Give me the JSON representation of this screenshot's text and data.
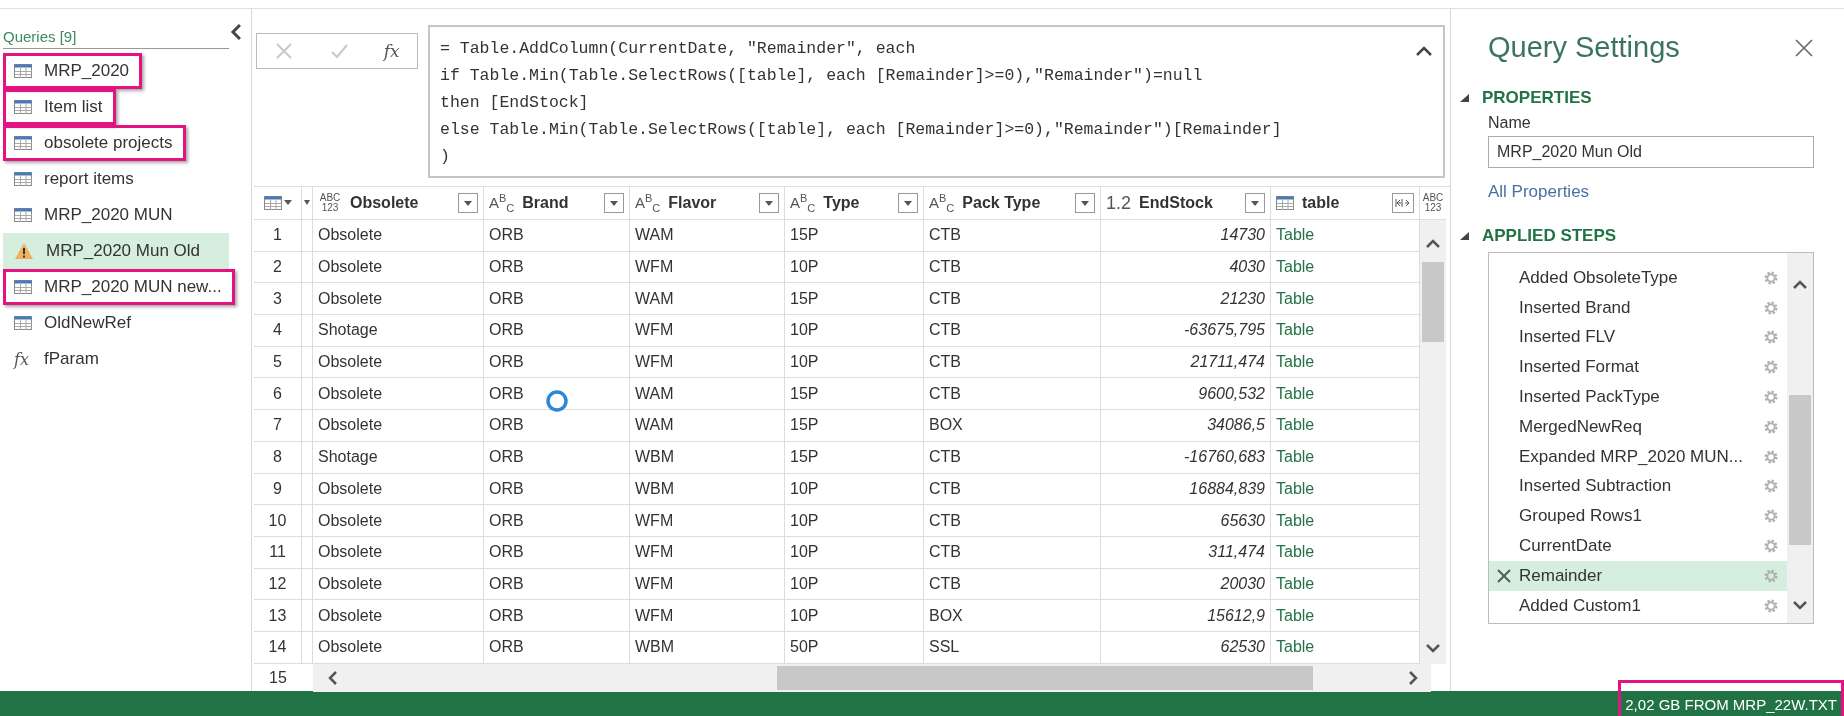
{
  "queries": {
    "title": "Queries [9]",
    "items": [
      {
        "name": "MRP_2020",
        "kind": "table",
        "selected": false,
        "highlighted": true
      },
      {
        "name": "Item list",
        "kind": "table",
        "selected": false,
        "highlighted": true
      },
      {
        "name": "obsolete projects",
        "kind": "table",
        "selected": false,
        "highlighted": true
      },
      {
        "name": "report items",
        "kind": "table",
        "selected": false,
        "highlighted": false
      },
      {
        "name": "MRP_2020 MUN",
        "kind": "table",
        "selected": false,
        "highlighted": false
      },
      {
        "name": "MRP_2020 Mun Old",
        "kind": "warning",
        "selected": true,
        "highlighted": false
      },
      {
        "name": "MRP_2020 MUN new...",
        "kind": "table",
        "selected": false,
        "highlighted": true
      },
      {
        "name": "OldNewRef",
        "kind": "table",
        "selected": false,
        "highlighted": false
      },
      {
        "name": "fParam",
        "kind": "function",
        "icon_label": "fx",
        "selected": false,
        "highlighted": false
      }
    ]
  },
  "formula_bar": {
    "function_label": "fx",
    "lines": [
      "= Table.AddColumn(CurrentDate, \"Remainder\", each",
      "if Table.Min(Table.SelectRows([table], each [Remainder]>=0),\"Remainder\")=null",
      "then [EndStock]",
      "else Table.Min(Table.SelectRows([table], each [Remainder]>=0),\"Remainder\")[Remainder]",
      ")"
    ]
  },
  "table": {
    "columns": [
      {
        "name": "Obsolete",
        "kind": "any",
        "type_label": "ABC 123"
      },
      {
        "name": "Brand",
        "kind": "text",
        "type_label": "A$^{B}$$_{C}$"
      },
      {
        "name": "Flavor",
        "kind": "text",
        "type_label": "A$^{B}$$_{C}$"
      },
      {
        "name": "Type",
        "kind": "text",
        "type_label": "A$^{B}$$_{C}$"
      },
      {
        "name": "Pack Type",
        "kind": "text",
        "type_label": "A$^{B}$$_{C}$"
      },
      {
        "name": "EndStock",
        "kind": "number",
        "type_label": "1.2"
      },
      {
        "name": "table",
        "kind": "table"
      },
      {
        "kind": "any",
        "type_label": "ABC 123"
      }
    ],
    "rows": [
      {
        "number": "1",
        "cells": [
          "Obsolete",
          "ORB",
          "WAM",
          "15P",
          "CTB",
          "14730",
          "Table"
        ]
      },
      {
        "number": "2",
        "cells": [
          "Obsolete",
          "ORB",
          "WFM",
          "10P",
          "CTB",
          "4030",
          "Table"
        ]
      },
      {
        "number": "3",
        "cells": [
          "Obsolete",
          "ORB",
          "WAM",
          "15P",
          "CTB",
          "21230",
          "Table"
        ]
      },
      {
        "number": "4",
        "cells": [
          "Shotage",
          "ORB",
          "WFM",
          "10P",
          "CTB",
          "-63675,795",
          "Table"
        ]
      },
      {
        "number": "5",
        "cells": [
          "Obsolete",
          "ORB",
          "WFM",
          "10P",
          "CTB",
          "21711,474",
          "Table"
        ]
      },
      {
        "number": "6",
        "cells": [
          "Obsolete",
          "ORB",
          "WAM",
          "15P",
          "CTB",
          "9600,532",
          "Table"
        ]
      },
      {
        "number": "7",
        "cells": [
          "Obsolete",
          "ORB",
          "WAM",
          "15P",
          "BOX",
          "34086,5",
          "Table"
        ]
      },
      {
        "number": "8",
        "cells": [
          "Shotage",
          "ORB",
          "WBM",
          "15P",
          "CTB",
          "-16760,683",
          "Table"
        ]
      },
      {
        "number": "9",
        "cells": [
          "Obsolete",
          "ORB",
          "WBM",
          "10P",
          "CTB",
          "16884,839",
          "Table"
        ]
      },
      {
        "number": "10",
        "cells": [
          "Obsolete",
          "ORB",
          "WFM",
          "10P",
          "CTB",
          "65630",
          "Table"
        ]
      },
      {
        "number": "11",
        "cells": [
          "Obsolete",
          "ORB",
          "WFM",
          "10P",
          "CTB",
          "311,474",
          "Table"
        ]
      },
      {
        "number": "12",
        "cells": [
          "Obsolete",
          "ORB",
          "WFM",
          "10P",
          "CTB",
          "20030",
          "Table"
        ]
      },
      {
        "number": "13",
        "cells": [
          "Obsolete",
          "ORB",
          "WFM",
          "10P",
          "BOX",
          "15612,9",
          "Table"
        ]
      },
      {
        "number": "14",
        "cells": [
          "Obsolete",
          "ORB",
          "WBM",
          "50P",
          "SSL",
          "62530",
          "Table"
        ]
      },
      {
        "number": "15"
      }
    ]
  },
  "query_settings": {
    "title": "Query Settings",
    "properties": {
      "heading": "PROPERTIES",
      "name_label": "Name",
      "name_value": "MRP_2020 Mun Old",
      "link": "All Properties"
    },
    "applied_steps": {
      "heading": "APPLIED STEPS",
      "steps": [
        {
          "name": "Added ObsoleteType",
          "selected": false
        },
        {
          "name": "Inserted Brand",
          "selected": false
        },
        {
          "name": "Inserted FLV",
          "selected": false
        },
        {
          "name": "Inserted Format",
          "selected": false
        },
        {
          "name": "Inserted PackType",
          "selected": false
        },
        {
          "name": "MergedNewReq",
          "selected": false
        },
        {
          "name": "Expanded MRP_2020 MUN...",
          "selected": false
        },
        {
          "name": "Inserted Subtraction",
          "selected": false
        },
        {
          "name": "Grouped Rows1",
          "selected": false
        },
        {
          "name": "CurrentDate",
          "selected": false
        },
        {
          "name": "Remainder",
          "selected": true
        },
        {
          "name": "Added Custom1",
          "selected": false
        }
      ]
    }
  },
  "status_bar": {
    "text": "2,02 GB FROM MRP_22W.TXT",
    "highlighted": true
  }
}
